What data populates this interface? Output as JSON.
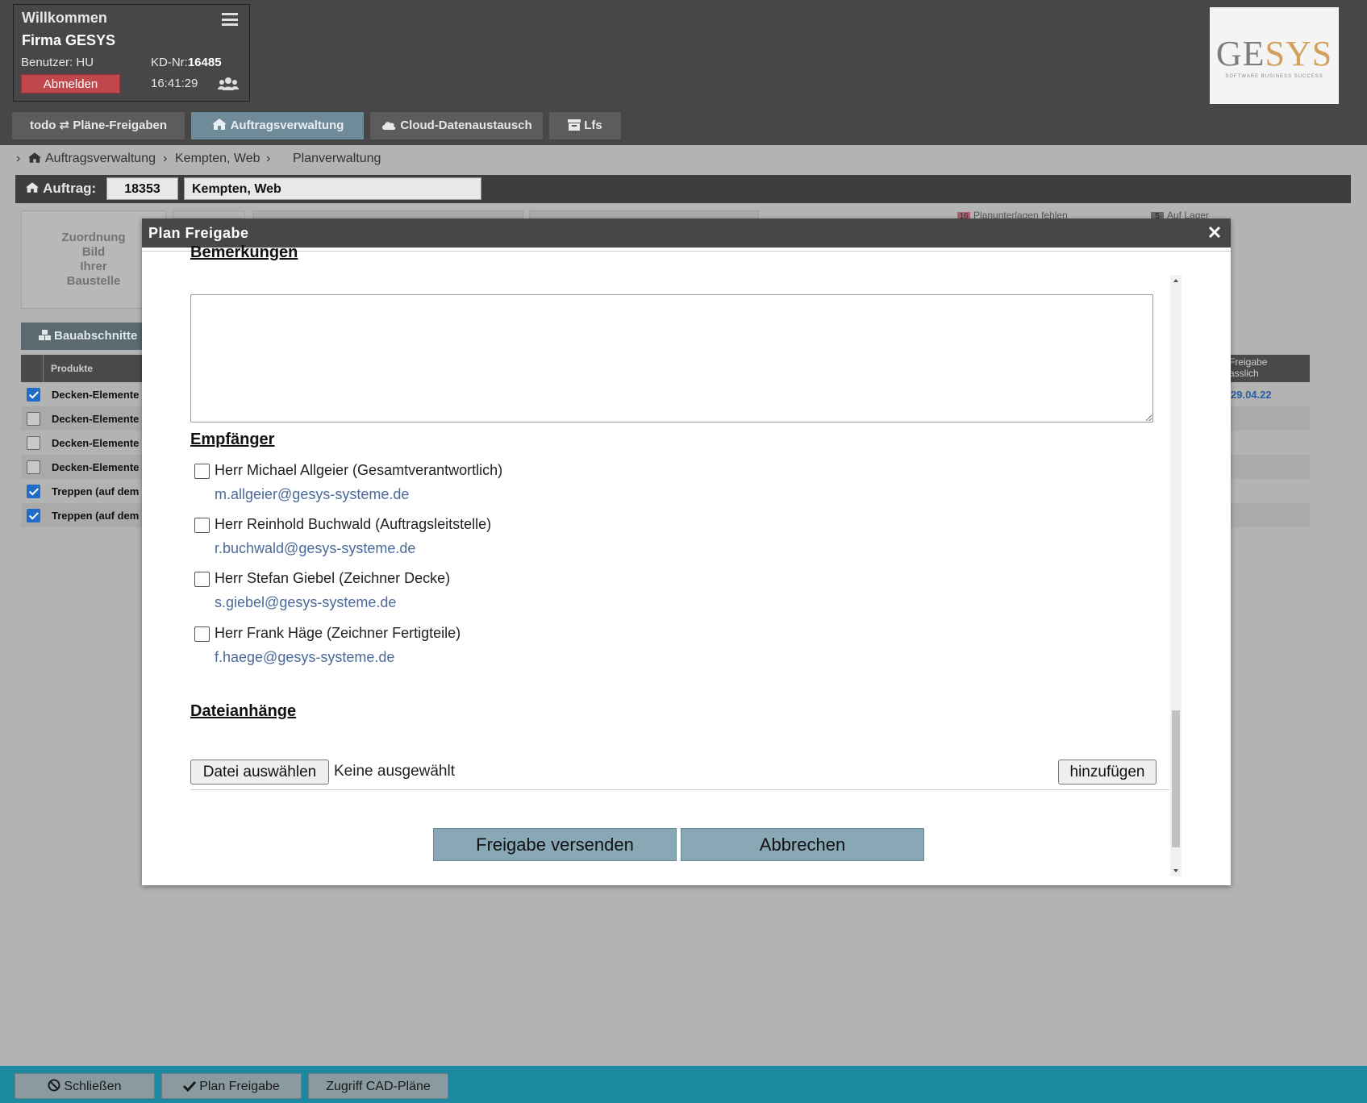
{
  "header": {
    "welcome": "Willkommen",
    "company": "Firma GESYS",
    "user_label": "Benutzer:",
    "user_value": "HU",
    "kd_label": "KD-Nr:",
    "kd_value": "16485",
    "logout_label": "Abmelden",
    "time": "16:41:29",
    "logo_main": "GE",
    "logo_accent": "SYS",
    "logo_sub": "SOFTWARE BUSINESS SUCCESS"
  },
  "nav": {
    "tabs": [
      {
        "label": "todo ⇄ Pläne-Freigaben"
      },
      {
        "label": "Auftragsverwaltung"
      },
      {
        "label": "Cloud-Datenaustausch"
      },
      {
        "label": "Lfs"
      }
    ]
  },
  "breadcrumb": {
    "items": [
      "Auftragsverwaltung",
      "Kempten, Web",
      "Planverwaltung"
    ]
  },
  "auftrag": {
    "label": "Auftrag:",
    "number": "18353",
    "name": "Kempten, Web"
  },
  "background": {
    "zuordnung": [
      "Zuordnung",
      "Bild",
      "Ihrer",
      "Baustelle"
    ],
    "badge1_count": "16",
    "badge1_text": "Planunterlagen fehlen",
    "badge2_count": "5",
    "badge2_text": "Auf Lager",
    "bauabschnitte": "Bauabschnitte",
    "col_produkte": "Produkte",
    "col_freigabe_1": "Freigabe",
    "col_freigabe_2": "asslich",
    "rows": [
      {
        "name": "Decken-Elemente",
        "checked": true,
        "date": "29.04.22"
      },
      {
        "name": "Decken-Elemente",
        "checked": false,
        "date": ""
      },
      {
        "name": "Decken-Elemente",
        "checked": false,
        "date": ""
      },
      {
        "name": "Decken-Elemente",
        "checked": false,
        "date": ""
      },
      {
        "name": "Treppen (auf dem",
        "checked": true,
        "date": ""
      },
      {
        "name": "Treppen (auf dem",
        "checked": true,
        "date": ""
      }
    ]
  },
  "modal": {
    "title": "Plan Freigabe",
    "remarks_title": "Bemerkungen",
    "remarks_value": "",
    "recipients_title": "Empfänger",
    "recipients": [
      {
        "name": "Herr Michael Allgeier (Gesamtverantwortlich)",
        "email": "m.allgeier@gesys-systeme.de"
      },
      {
        "name": "Herr Reinhold Buchwald (Auftragsleitstelle)",
        "email": "r.buchwald@gesys-systeme.de"
      },
      {
        "name": "Herr Stefan Giebel (Zeichner Decke)",
        "email": "s.giebel@gesys-systeme.de"
      },
      {
        "name": "Herr Frank Häge (Zeichner Fertigteile)",
        "email": "f.haege@gesys-systeme.de"
      }
    ],
    "attachments_title": "Dateianhänge",
    "choose_file_label": "Datei auswählen",
    "file_status": "Keine ausgewählt",
    "add_label": "hinzufügen",
    "send_label": "Freigabe versenden",
    "cancel_label": "Abbrechen"
  },
  "footer": {
    "close_label": "Schließen",
    "plan_label": "Plan Freigabe",
    "cad_label": "Zugriff CAD-Pläne"
  },
  "colors": {
    "header_bg": "#474747",
    "logout": "#c0474b",
    "active_tab": "#6f8b99",
    "footer_bg": "#1b8aa0",
    "action_btn": "#89a8b6",
    "link": "#4a6a9a"
  }
}
